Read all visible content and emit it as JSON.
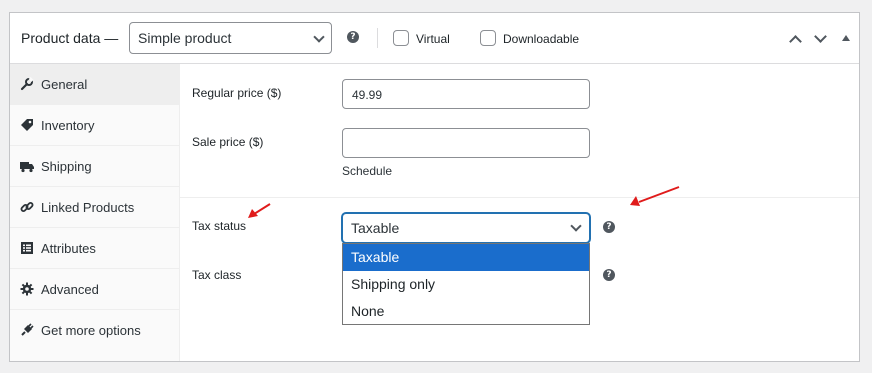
{
  "header": {
    "title": "Product data —",
    "product_type": "Simple product",
    "virtual_label": "Virtual",
    "downloadable_label": "Downloadable"
  },
  "sidebar": {
    "items": [
      {
        "label": "General",
        "icon": "wrench-icon",
        "active": true
      },
      {
        "label": "Inventory",
        "icon": "tag-icon"
      },
      {
        "label": "Shipping",
        "icon": "truck-icon"
      },
      {
        "label": "Linked Products",
        "icon": "link-icon"
      },
      {
        "label": "Attributes",
        "icon": "list-icon"
      },
      {
        "label": "Advanced",
        "icon": "gear-icon"
      },
      {
        "label": "Get more options",
        "icon": "plugin-icon"
      }
    ]
  },
  "general": {
    "regular_price_label": "Regular price ($)",
    "regular_price_value": "49.99",
    "sale_price_label": "Sale price ($)",
    "sale_price_value": "",
    "schedule_link": "Schedule",
    "tax_status_label": "Tax status",
    "tax_status_value": "Taxable",
    "tax_status_options": [
      "Taxable",
      "Shipping only",
      "None"
    ],
    "tax_class_label": "Tax class"
  },
  "colors": {
    "accent": "#2271b1",
    "selected_option": "#1a6dcc",
    "annotation_arrow": "#e01b1b"
  }
}
